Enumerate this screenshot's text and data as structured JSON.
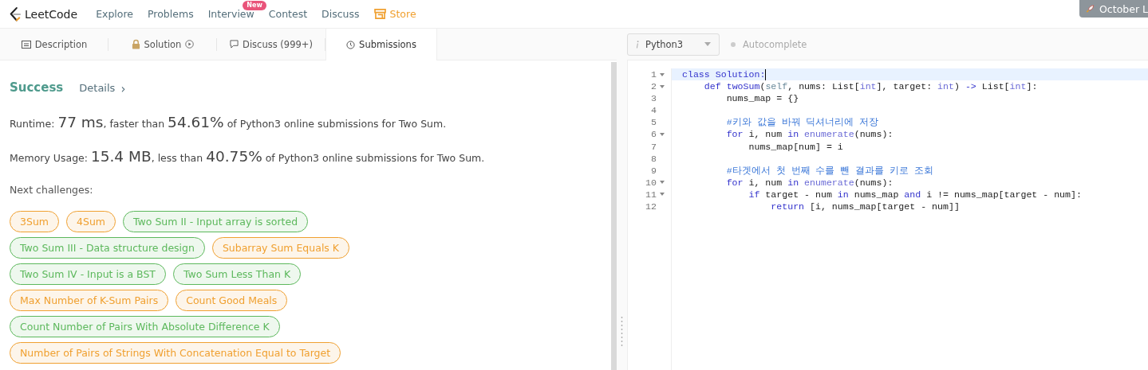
{
  "nav": {
    "logo": "LeetCode",
    "items": [
      {
        "label": "Explore",
        "kind": "link"
      },
      {
        "label": "Problems",
        "kind": "link"
      },
      {
        "label": "Interview",
        "kind": "link",
        "badge": "New"
      },
      {
        "label": "Contest",
        "kind": "link"
      },
      {
        "label": "Discuss",
        "kind": "link"
      },
      {
        "label": "Store",
        "kind": "store"
      }
    ],
    "promo": "October L"
  },
  "tabs": [
    {
      "label": "Description",
      "kind": "description",
      "selected": false
    },
    {
      "label": "Solution",
      "kind": "solution",
      "selected": false
    },
    {
      "label": "Discuss (999+)",
      "kind": "discuss",
      "selected": false
    },
    {
      "label": "Submissions",
      "kind": "submissions",
      "selected": true
    }
  ],
  "result": {
    "status": "Success",
    "details": "Details",
    "details_arrow": "›",
    "stats": [
      {
        "parts": [
          {
            "text": "Runtime: ",
            "big": false
          },
          {
            "text": "77 ms",
            "big": true
          },
          {
            "text": ", faster than ",
            "big": false
          },
          {
            "text": "54.61%",
            "big": true
          },
          {
            "text": " of Python3 online submissions for Two Sum.",
            "big": false
          }
        ]
      },
      {
        "parts": [
          {
            "text": "Memory Usage: ",
            "big": false
          },
          {
            "text": "15.4 MB",
            "big": true
          },
          {
            "text": ", less than ",
            "big": false
          },
          {
            "text": "40.75%",
            "big": true
          },
          {
            "text": " of Python3 online submissions for Two Sum.",
            "big": false
          }
        ]
      }
    ],
    "next_label": "Next challenges:",
    "challenges": [
      {
        "label": "3Sum",
        "color": "#f0a030"
      },
      {
        "label": "4Sum",
        "color": "#f0a030"
      },
      {
        "label": "Two Sum II - Input array is sorted",
        "color": "#5cb85c"
      },
      {
        "label": "Two Sum III - Data structure design",
        "color": "#5cb85c"
      },
      {
        "label": "Subarray Sum Equals K",
        "color": "#f0a030"
      },
      {
        "label": "Two Sum IV - Input is a BST",
        "color": "#5cb85c"
      },
      {
        "label": "Two Sum Less Than K",
        "color": "#5cb85c"
      },
      {
        "label": "Max Number of K-Sum Pairs",
        "color": "#f0a030"
      },
      {
        "label": "Count Good Meals",
        "color": "#f0a030"
      },
      {
        "label": "Count Number of Pairs With Absolute Difference K",
        "color": "#5cb85c"
      },
      {
        "label": "Number of Pairs of Strings With Concatenation Equal to Target",
        "color": "#f0a030"
      }
    ]
  },
  "editor": {
    "language": "Python3",
    "autocomplete": "Autocomplete",
    "lines": [
      {
        "number": "1",
        "foldable": true,
        "active": true,
        "tokens": [
          {
            "kind": "kw",
            "text": "class "
          },
          {
            "kind": "kw",
            "text": "Solution:"
          }
        ]
      },
      {
        "number": "2",
        "foldable": true,
        "active": false,
        "tokens": [
          {
            "kind": "kw",
            "text": "    def "
          },
          {
            "kind": "kw",
            "text": "twoSum"
          },
          {
            "kind": "plain",
            "text": "("
          },
          {
            "kind": "self",
            "text": "self"
          },
          {
            "kind": "plain",
            "text": ", nums: List["
          },
          {
            "kind": "builtin",
            "text": "int"
          },
          {
            "kind": "plain",
            "text": "], target: "
          },
          {
            "kind": "builtin",
            "text": "int"
          },
          {
            "kind": "plain",
            "text": ") "
          },
          {
            "kind": "op",
            "text": "->"
          },
          {
            "kind": "plain",
            "text": " List["
          },
          {
            "kind": "builtin",
            "text": "int"
          },
          {
            "kind": "plain",
            "text": "]:"
          }
        ]
      },
      {
        "number": "3",
        "foldable": false,
        "active": false,
        "tokens": [
          {
            "kind": "plain",
            "text": "        nums_map = {}"
          }
        ]
      },
      {
        "number": "4",
        "foldable": false,
        "active": false
      },
      {
        "number": "5",
        "foldable": false,
        "active": false,
        "tokens": [
          {
            "kind": "comment",
            "text": "        #키와 값을 바꿔 딕셔너리에 저장"
          }
        ]
      },
      {
        "number": "6",
        "foldable": true,
        "active": false,
        "tokens": [
          {
            "kind": "kw",
            "text": "        for"
          },
          {
            "kind": "plain",
            "text": " i, num "
          },
          {
            "kind": "kw",
            "text": "in"
          },
          {
            "kind": "builtin",
            "text": " enumerate"
          },
          {
            "kind": "plain",
            "text": "(nums):"
          }
        ]
      },
      {
        "number": "7",
        "foldable": false,
        "active": false,
        "tokens": [
          {
            "kind": "plain",
            "text": "            nums_map[num] = i"
          }
        ]
      },
      {
        "number": "8",
        "foldable": false,
        "active": false
      },
      {
        "number": "9",
        "foldable": false,
        "active": false,
        "tokens": [
          {
            "kind": "comment",
            "text": "        #타겟에서 첫 번째 수를 뺀 결과를 키로 조회"
          }
        ]
      },
      {
        "number": "10",
        "foldable": true,
        "active": false,
        "tokens": [
          {
            "kind": "kw",
            "text": "        for"
          },
          {
            "kind": "plain",
            "text": " i, num "
          },
          {
            "kind": "kw",
            "text": "in"
          },
          {
            "kind": "builtin",
            "text": " enumerate"
          },
          {
            "kind": "plain",
            "text": "(nums):"
          }
        ]
      },
      {
        "number": "11",
        "foldable": true,
        "active": false,
        "tokens": [
          {
            "kind": "kw",
            "text": "            if"
          },
          {
            "kind": "plain",
            "text": " target - num "
          },
          {
            "kind": "kw",
            "text": "in"
          },
          {
            "kind": "plain",
            "text": " nums_map "
          },
          {
            "kind": "kw",
            "text": "and"
          },
          {
            "kind": "plain",
            "text": " i != nums_map[target - num]:"
          }
        ]
      },
      {
        "number": "12",
        "foldable": false,
        "active": false,
        "tokens": [
          {
            "kind": "kw",
            "text": "                return"
          },
          {
            "kind": "plain",
            "text": " [i, nums_map[target - num]]"
          }
        ]
      }
    ]
  }
}
